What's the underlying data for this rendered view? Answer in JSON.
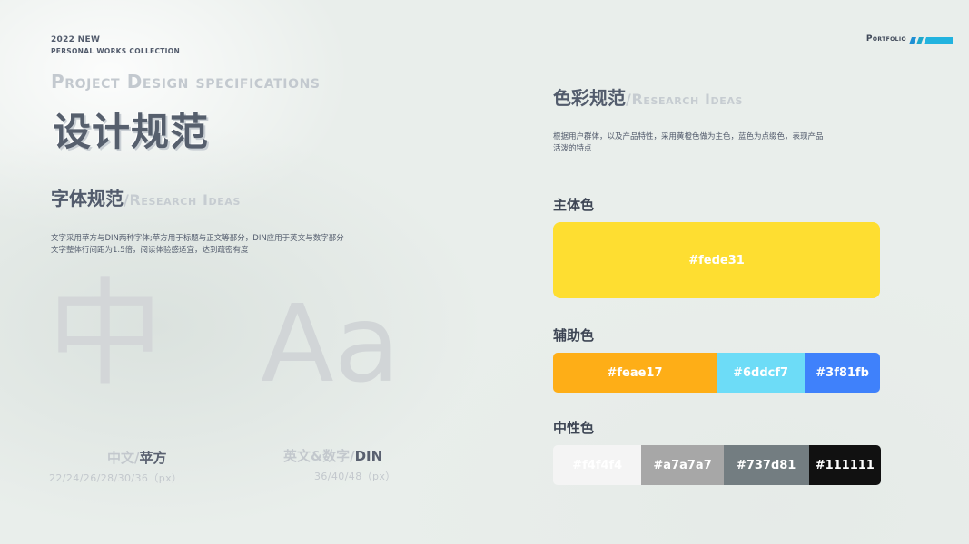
{
  "header": {
    "year_line": "2022 NEW",
    "collection_line": "PERSONAL WORKS COLLECTION",
    "project_title": "Project Design specifications",
    "main_title": "设计规范"
  },
  "portfolio": {
    "label": "Portfolio",
    "bar_colors": [
      "#1f8fd4",
      "#1fa8cc",
      "#22b3df"
    ]
  },
  "font_spec": {
    "title": "字体规范",
    "subtitle": "/Research Ideas",
    "description": "文字采用苹方与DIN两种字体;苹方用于标题与正文等部分，DIN应用于英文与数字部分文字整体行间距为1.5倍，阅读体验感适宜，达到疏密有度",
    "sample_chinese": "中",
    "sample_latin": "Aa",
    "chinese_label_prefix": "中文/",
    "chinese_label_font": "苹方",
    "chinese_sizes": "22/24/26/28/30/36（px）",
    "english_label_prefix": "英文&数字/",
    "english_label_font": "DIN",
    "english_sizes": "36/40/48（px）"
  },
  "color_spec": {
    "title": "色彩规范",
    "subtitle": "/Research Ideas",
    "description": "根据用户群体，以及产品特性，采用黄橙色做为主色，蓝色为点缀色，表现产品活泼的特点",
    "primary": {
      "label": "主体色",
      "color": "#fede31",
      "text": "#fede31"
    },
    "auxiliary": {
      "label": "辅助色",
      "swatches": [
        {
          "color": "#feae17",
          "text": "#feae17",
          "share": 0.5
        },
        {
          "color": "#6ddcf7",
          "text": "#6ddcf7",
          "share": 0.27
        },
        {
          "color": "#3f81fb",
          "text": "#3f81fb",
          "share": 0.23
        }
      ]
    },
    "neutral": {
      "label": "中性色",
      "swatches": [
        {
          "color": "#f4f4f4",
          "text": "#f4f4f4",
          "share": 0.27
        },
        {
          "color": "#a7a7a7",
          "text": "#a7a7a7",
          "share": 0.25
        },
        {
          "color": "#737d81",
          "text": "#737d81",
          "share": 0.26
        },
        {
          "color": "#111111",
          "text": "#111111",
          "share": 0.22
        }
      ]
    }
  }
}
